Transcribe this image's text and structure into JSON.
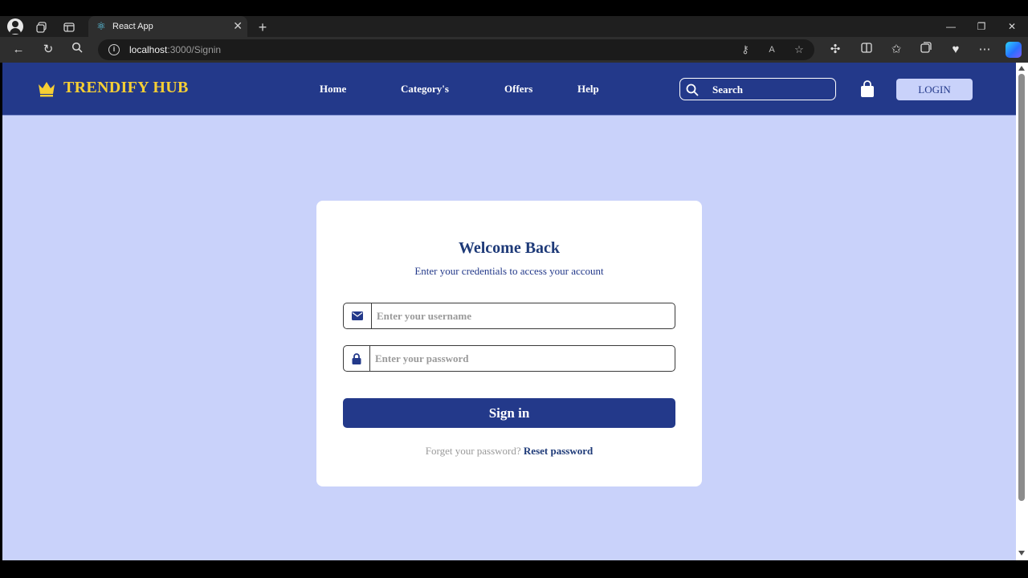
{
  "browser": {
    "tab_title": "React App",
    "tab_icon": "react-icon",
    "url_host": "localhost",
    "url_path": ":3000/Signin",
    "accent": "#2e2e2e"
  },
  "navbar": {
    "brand": "TRENDIFY HUB",
    "brand_color": "#f6cf34",
    "bg_color": "#23398a",
    "links": [
      "Home",
      "Category's",
      "Offers",
      "Help"
    ],
    "search_placeholder": "Search",
    "login_label": "LOGIN"
  },
  "signin": {
    "title": "Welcome Back",
    "subtitle": "Enter your credentials to access your account",
    "username_placeholder": "Enter your username",
    "password_placeholder": "Enter your password",
    "button_label": "Sign in",
    "forgot_text": "Forget your password?",
    "reset_link": "Reset password",
    "page_bg": "#c9d2fa"
  }
}
